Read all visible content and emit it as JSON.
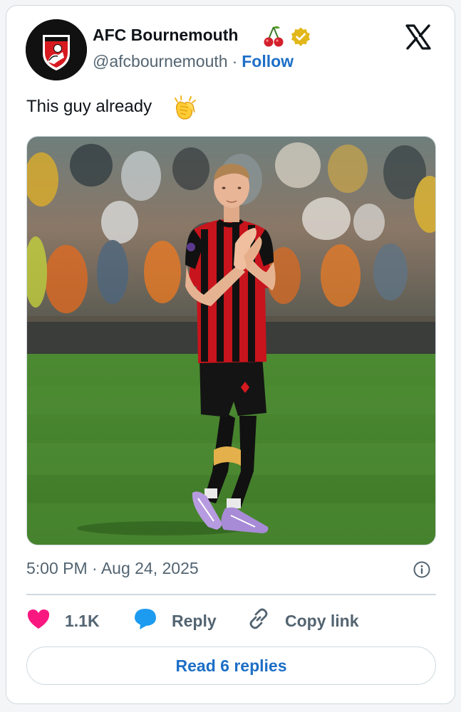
{
  "author": {
    "display_name": "AFC Bournemouth",
    "name_emoji": "cherries-emoji",
    "verified": "verified-gold-badge",
    "handle": "@afcbournemouth",
    "separator": "·",
    "follow_label": "Follow",
    "avatar_crest_text": "AFC BOURNEMOUTH"
  },
  "platform_icon": "x-logo",
  "tweet": {
    "text": "This guy already",
    "text_emoji": "clapping-hands-emoji",
    "media_alt": "player-applauding-photo"
  },
  "meta": {
    "timestamp": "5:00 PM · Aug 24, 2025",
    "info_icon": "info-icon"
  },
  "actions": {
    "like_count": "1.1K",
    "reply_label": "Reply",
    "copy_label": "Copy link"
  },
  "read_replies_label": "Read 6 replies",
  "colors": {
    "link_blue": "#1d6fc6",
    "like_pink": "#f91880",
    "reply_blue": "#1d9bf0",
    "text_primary": "#0f1419",
    "text_secondary": "#536471",
    "border": "#cfd9de",
    "verified_gold": "#e2b719"
  }
}
